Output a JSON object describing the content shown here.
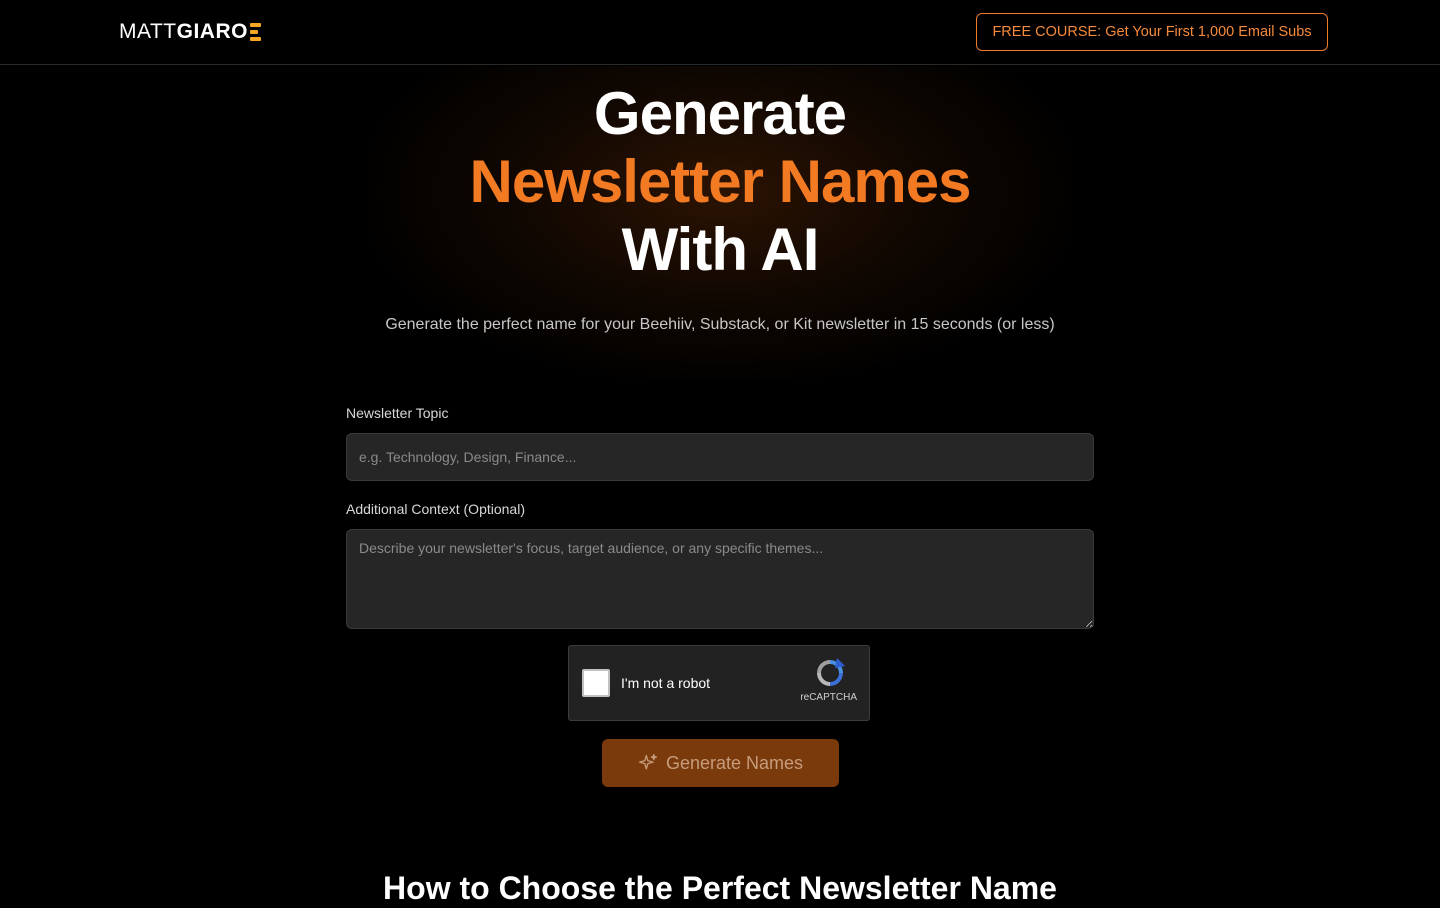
{
  "header": {
    "logo_light": "MATT",
    "logo_bold": "GIARO",
    "cta_label": "FREE COURSE: Get Your First 1,000 Email Subs"
  },
  "hero": {
    "title_line1": "Generate",
    "title_line2": "Newsletter Names",
    "title_line3": "With AI",
    "subtitle": "Generate the perfect name for your Beehiiv, Substack, or Kit newsletter in 15 seconds (or less)"
  },
  "form": {
    "topic_label": "Newsletter Topic",
    "topic_placeholder": "e.g. Technology, Design, Finance...",
    "topic_value": "",
    "context_label": "Additional Context (Optional)",
    "context_placeholder": "Describe your newsletter's focus, target audience, or any specific themes...",
    "context_value": "",
    "captcha_label": "I'm not a robot",
    "captcha_brand": "reCAPTCHA",
    "submit_label": "Generate Names"
  },
  "section": {
    "title": "How to Choose the Perfect Newsletter Name"
  },
  "colors": {
    "accent": "#f27a22",
    "background": "#000000",
    "button_bg": "#7a3a0c",
    "logo_mark": "#f5a623"
  },
  "icons": {
    "logo_mark": "logo-bars-icon",
    "recaptcha": "recaptcha-icon",
    "submit": "sparkles-icon"
  }
}
